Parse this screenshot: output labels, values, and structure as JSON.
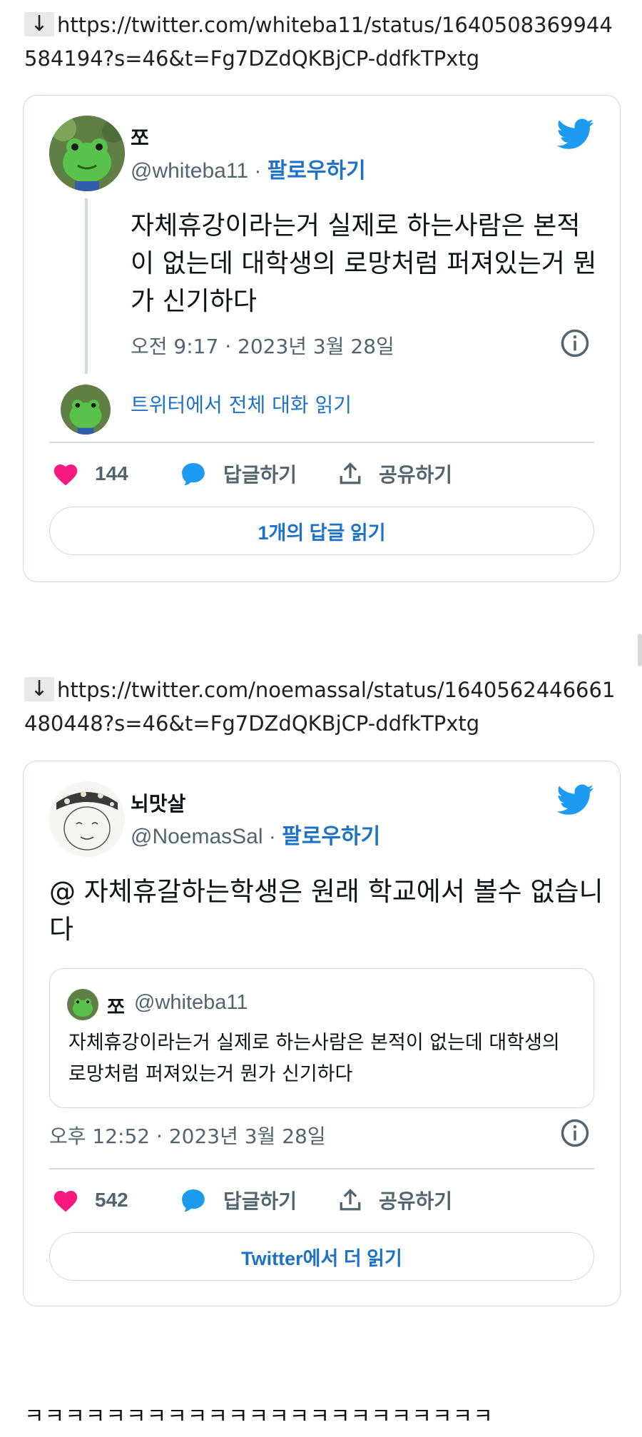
{
  "post1": {
    "arrow": "↓",
    "url": "https://twitter.com/whiteba11/status/1640508369944584194?s=46&t=Fg7DZdQKBjCP-ddfkTPxtg",
    "tweet": {
      "name": "쪼",
      "handle": "@whiteba11",
      "separator": "·",
      "follow": "팔로우하기",
      "text": "자체휴강이라는거 실제로 하는사람은 본적이 없는데 대학생의 로망처럼 퍼져있는거 뭔가 신기하다",
      "time": "오전 9:17 · 2023년 3월 28일",
      "read_convo": "트위터에서 전체 대화 읽기",
      "likes": "144",
      "reply": "답글하기",
      "share": "공유하기",
      "button": "1개의 답글 읽기"
    }
  },
  "post2": {
    "arrow": "↓",
    "url": "https://twitter.com/noemassal/status/1640562446661480448?s=46&t=Fg7DZdQKBjCP-ddfkTPxtg",
    "tweet": {
      "name": "뇌맛살",
      "handle": "@NoemasSal",
      "separator": "·",
      "follow": "팔로우하기",
      "text": "@ 자체휴갈하는학생은 원래 학교에서 볼수 없습니다",
      "quote": {
        "name": "쪼",
        "handle": "@whiteba11",
        "text": "자체휴강이라는거 실제로 하는사람은 본적이 없는데 대학생의 로망처럼 퍼져있는거 뭔가 신기하다"
      },
      "time": "오후 12:52 · 2023년 3월 28일",
      "likes": "542",
      "reply": "답글하기",
      "share": "공유하기",
      "button": "Twitter에서 더 읽기"
    }
  },
  "footer": "ㅋㅋㅋㅋㅋㅋㅋㅋㅋㅋㅋㅋㅋㅋㅋㅋㅋㅋㅋㅋㅋㅋㅋ",
  "colors": {
    "twitter_blue": "#1d9bf0",
    "link_blue": "#1d72c8",
    "heart_pink": "#f91880",
    "border": "#cfd9de",
    "muted": "#536471"
  },
  "icons": [
    "down-arrow-icon",
    "twitter-bird-icon",
    "info-icon",
    "heart-icon",
    "reply-bubble-icon",
    "share-icon"
  ]
}
